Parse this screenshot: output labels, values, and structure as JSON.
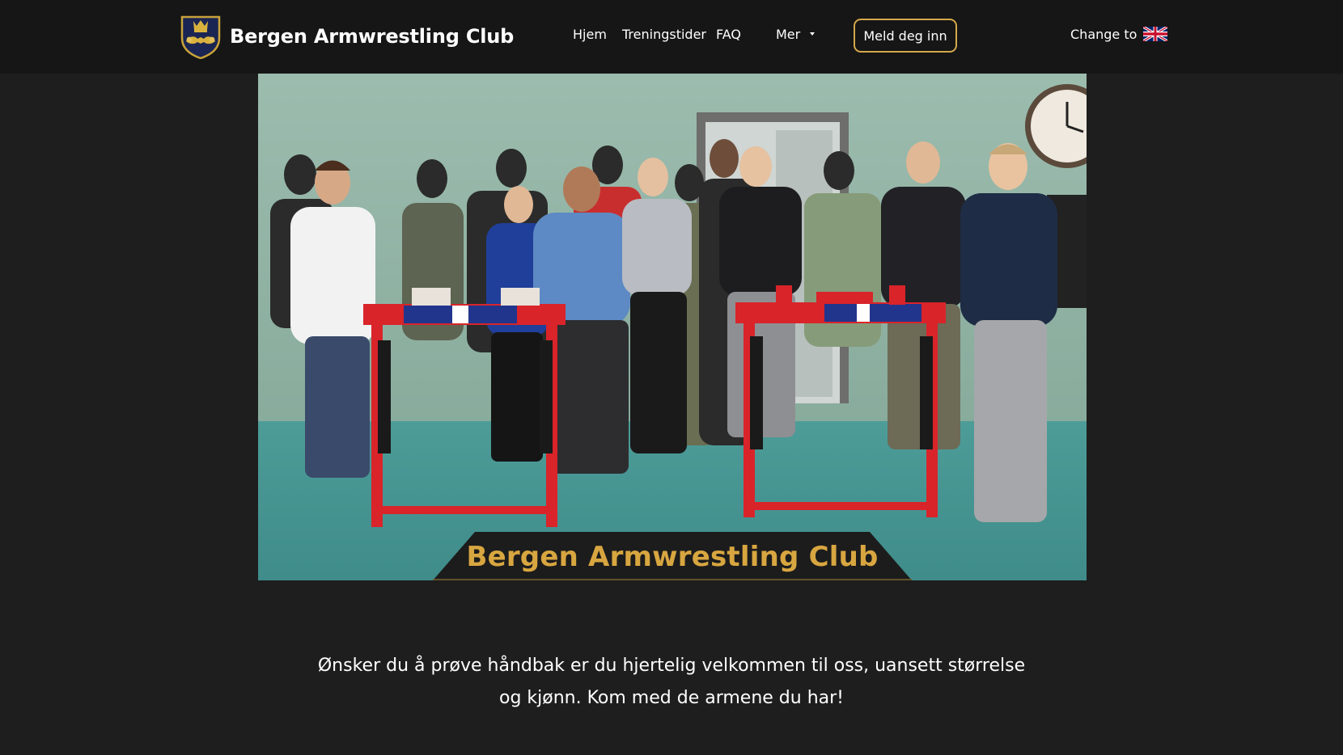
{
  "brand": {
    "name": "Bergen Armwrestling Club",
    "logo_icon": "crown-crest-icon"
  },
  "nav": {
    "items": [
      {
        "label": "Hjem"
      },
      {
        "label": "Treningstider"
      },
      {
        "label": "FAQ"
      },
      {
        "label": "Mer",
        "has_dropdown": true
      }
    ],
    "signup_label": "Meld deg inn",
    "language_label": "Change to",
    "language_icon": "uk-flag-icon"
  },
  "hero": {
    "banner_text": "Bergen Armwrestling Club"
  },
  "intro": {
    "text": "Ønsker du å prøve håndbak er du hjertelig velkommen til oss, uansett størrelse og kjønn. Kom med de armene du har!"
  },
  "colors": {
    "background": "#1e1e1e",
    "navbar": "#161616",
    "accent_gold": "#d4a84a",
    "banner_text": "#d8a640"
  }
}
